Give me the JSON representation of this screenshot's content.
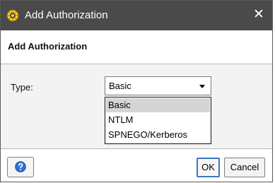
{
  "window": {
    "title": "Add Authorization",
    "close_symbol": "✕",
    "icon": "gear-badge-icon",
    "colors": {
      "titlebar": "#4a4a4a",
      "content_bg": "#f3f3f3",
      "selected_option": "#d5d5d5",
      "ok_focus": "#3d74c7"
    }
  },
  "header": {
    "title": "Add Authorization"
  },
  "form": {
    "type_label": "Type:",
    "type_select": {
      "value": "Basic",
      "options": [
        "Basic",
        "NTLM",
        "SPNEGO/Kerberos"
      ],
      "selected_option": "Basic"
    }
  },
  "footer": {
    "help_icon": "help-icon",
    "ok_label": "OK",
    "cancel_label": "Cancel"
  }
}
